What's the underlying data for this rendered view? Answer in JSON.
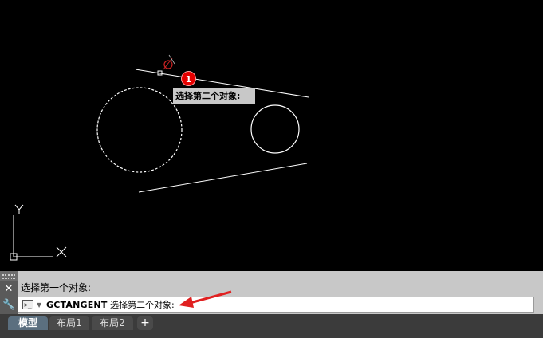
{
  "drawing": {
    "tooltip_text": "选择第二个对象:",
    "step_badge": "1"
  },
  "command_line": {
    "history_line": "选择第一个对象:",
    "command_name": "GCTANGENT",
    "current_prompt": "选择第二个对象:"
  },
  "layout_tabs": [
    {
      "label": "模型",
      "active": true
    },
    {
      "label": "布局1",
      "active": false
    },
    {
      "label": "布局2",
      "active": false
    }
  ],
  "add_tab_label": "+",
  "colors": {
    "canvas_bg": "#000000",
    "geometry": "#ffffff",
    "cursor": "#cc2222",
    "annotation_arrow": "#e02020",
    "command_panel": "#c8c8c8"
  },
  "icons": [
    "close-icon",
    "wrench-icon",
    "command-prompt-icon",
    "ucs-icon",
    "pickbox-cursor-icon"
  ]
}
